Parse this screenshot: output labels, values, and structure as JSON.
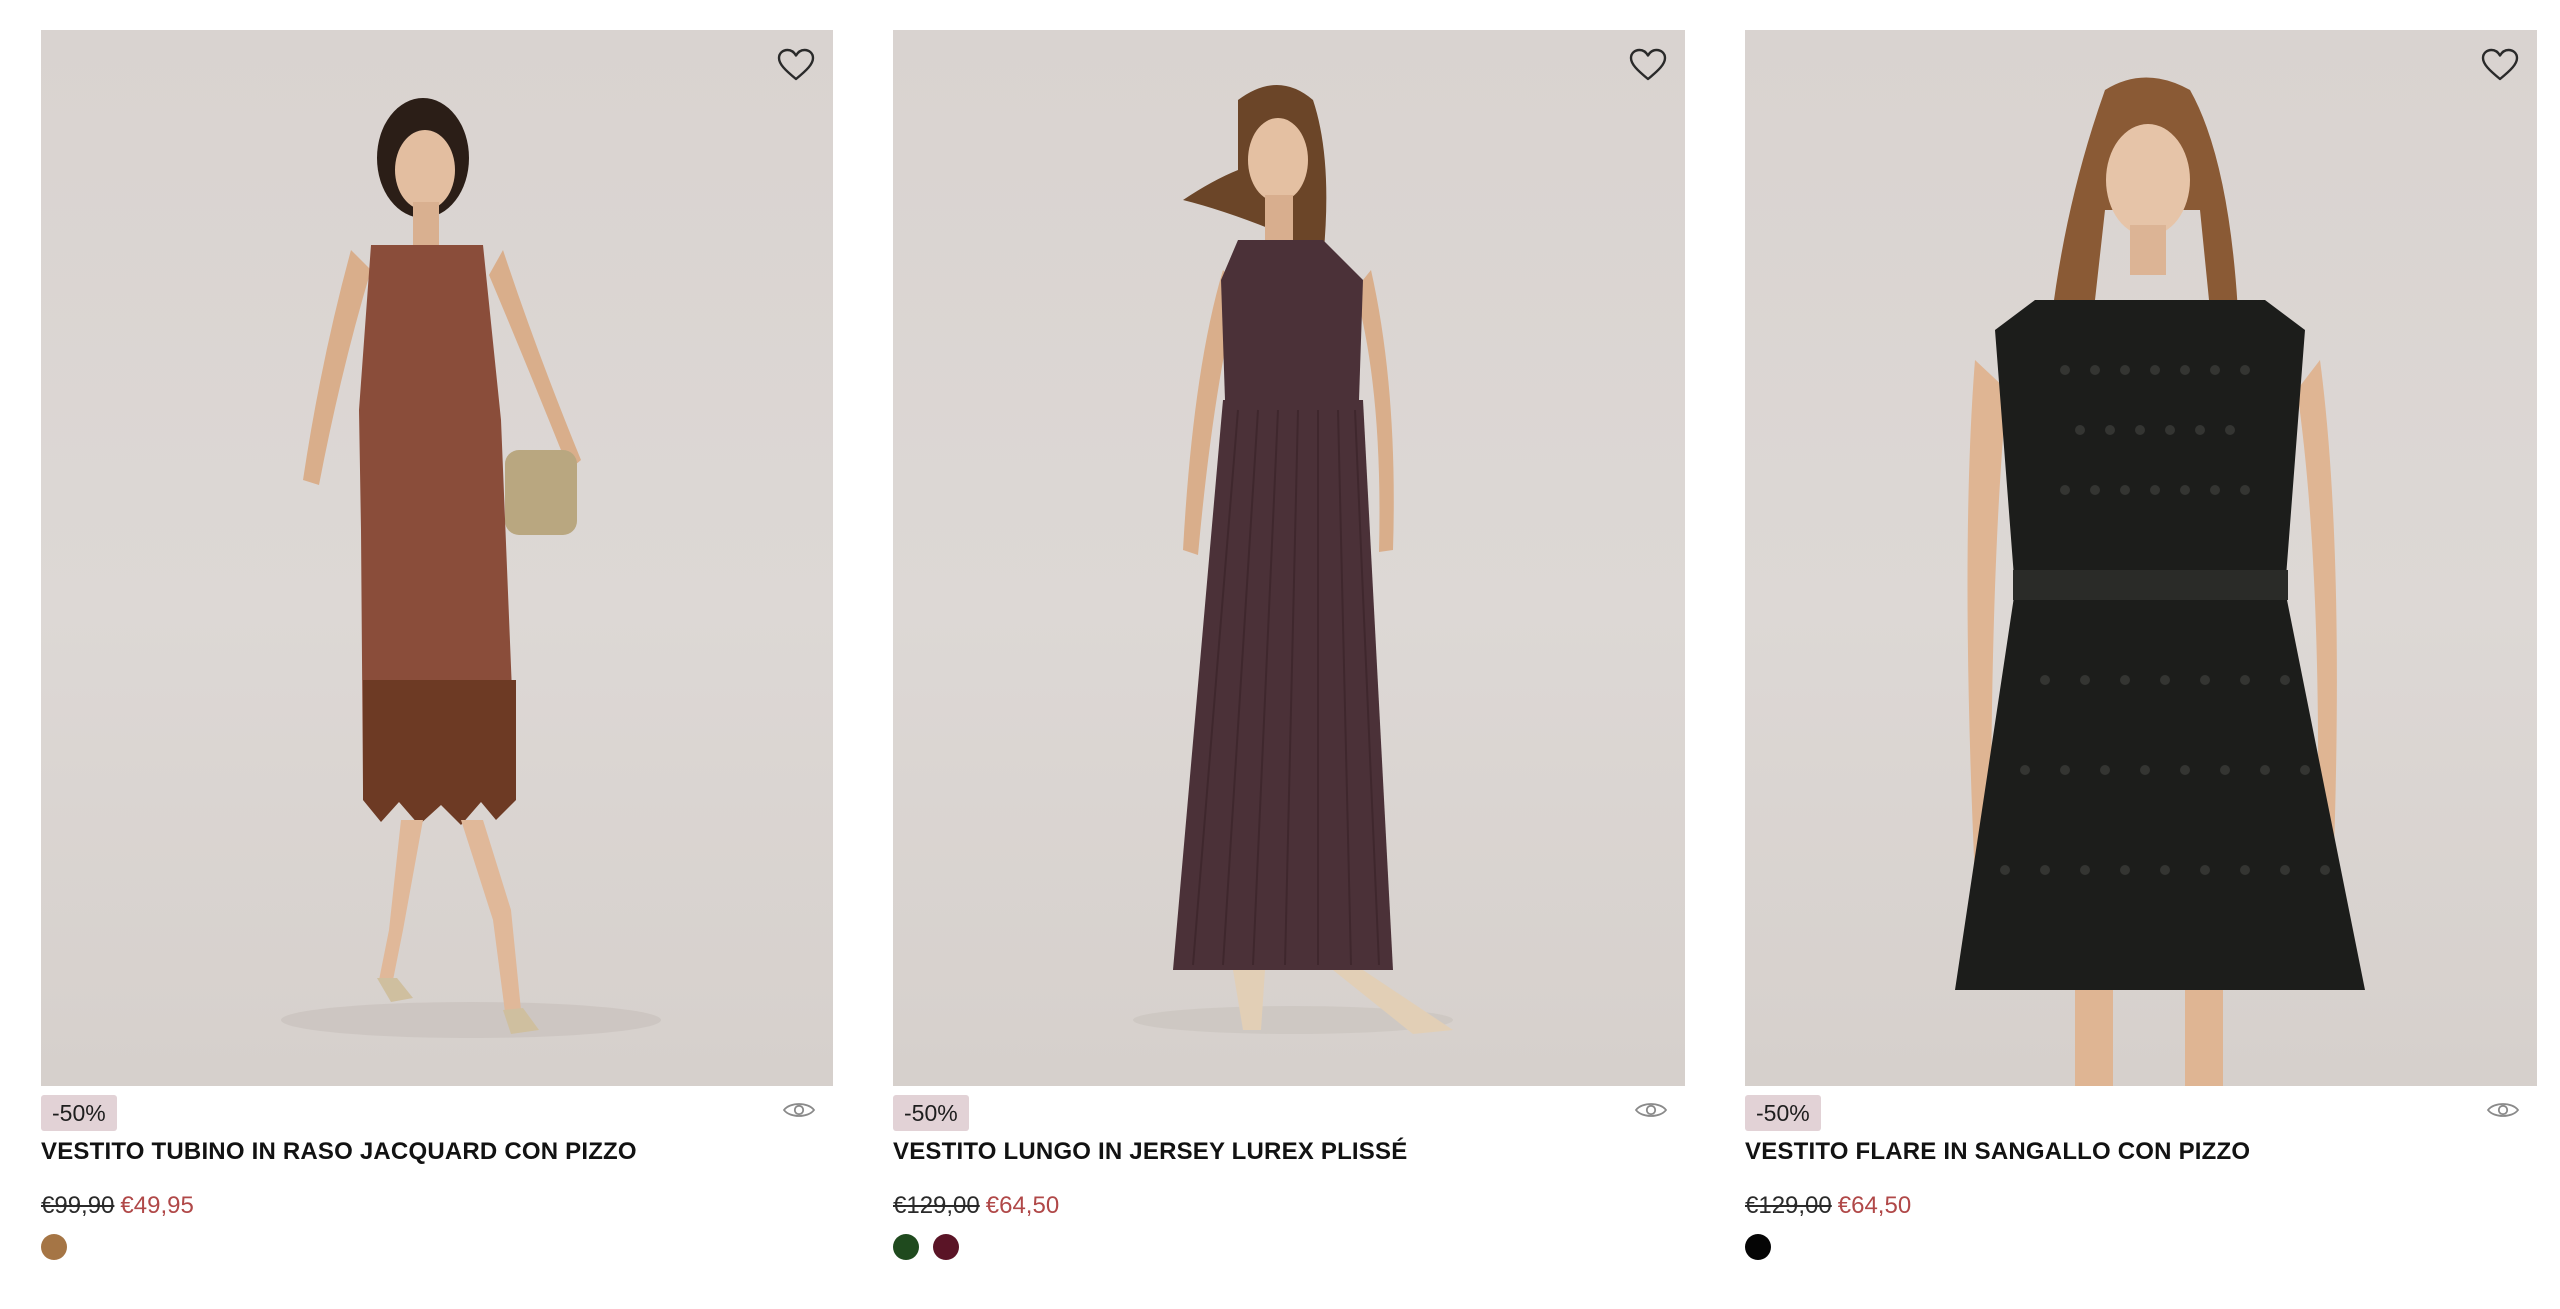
{
  "products": [
    {
      "discount": "-50%",
      "title": "VESTITO TUBINO IN RASO JACQUARD CON PIZZO",
      "old_price": "€99,90",
      "new_price": "€49,95",
      "swatches": [
        "#a57545"
      ],
      "dress_color": "#8a4d3a",
      "image_alt": "Model wearing a brown satin jacquard slip dress with lace hem"
    },
    {
      "discount": "-50%",
      "title": "VESTITO LUNGO IN JERSEY LUREX PLISSÉ",
      "old_price": "€129,00",
      "new_price": "€64,50",
      "swatches": [
        "#1f4a1e",
        "#5a1426"
      ],
      "dress_color": "#4b3138",
      "image_alt": "Model wearing a long pleated plum lurex jersey dress"
    },
    {
      "discount": "-50%",
      "title": "VESTITO FLARE IN SANGALLO CON PIZZO",
      "old_price": "€129,00",
      "new_price": "€64,50",
      "swatches": [
        "#050505"
      ],
      "dress_color": "#1c1d1b",
      "image_alt": "Model wearing a black broderie anglaise flare dress with lace sleeves"
    }
  ],
  "colors": {
    "badge_bg": "#e2d2d6",
    "sale_price": "#b04848"
  },
  "icons": {
    "wishlist": "heart-icon",
    "quick_view": "eye-icon"
  }
}
